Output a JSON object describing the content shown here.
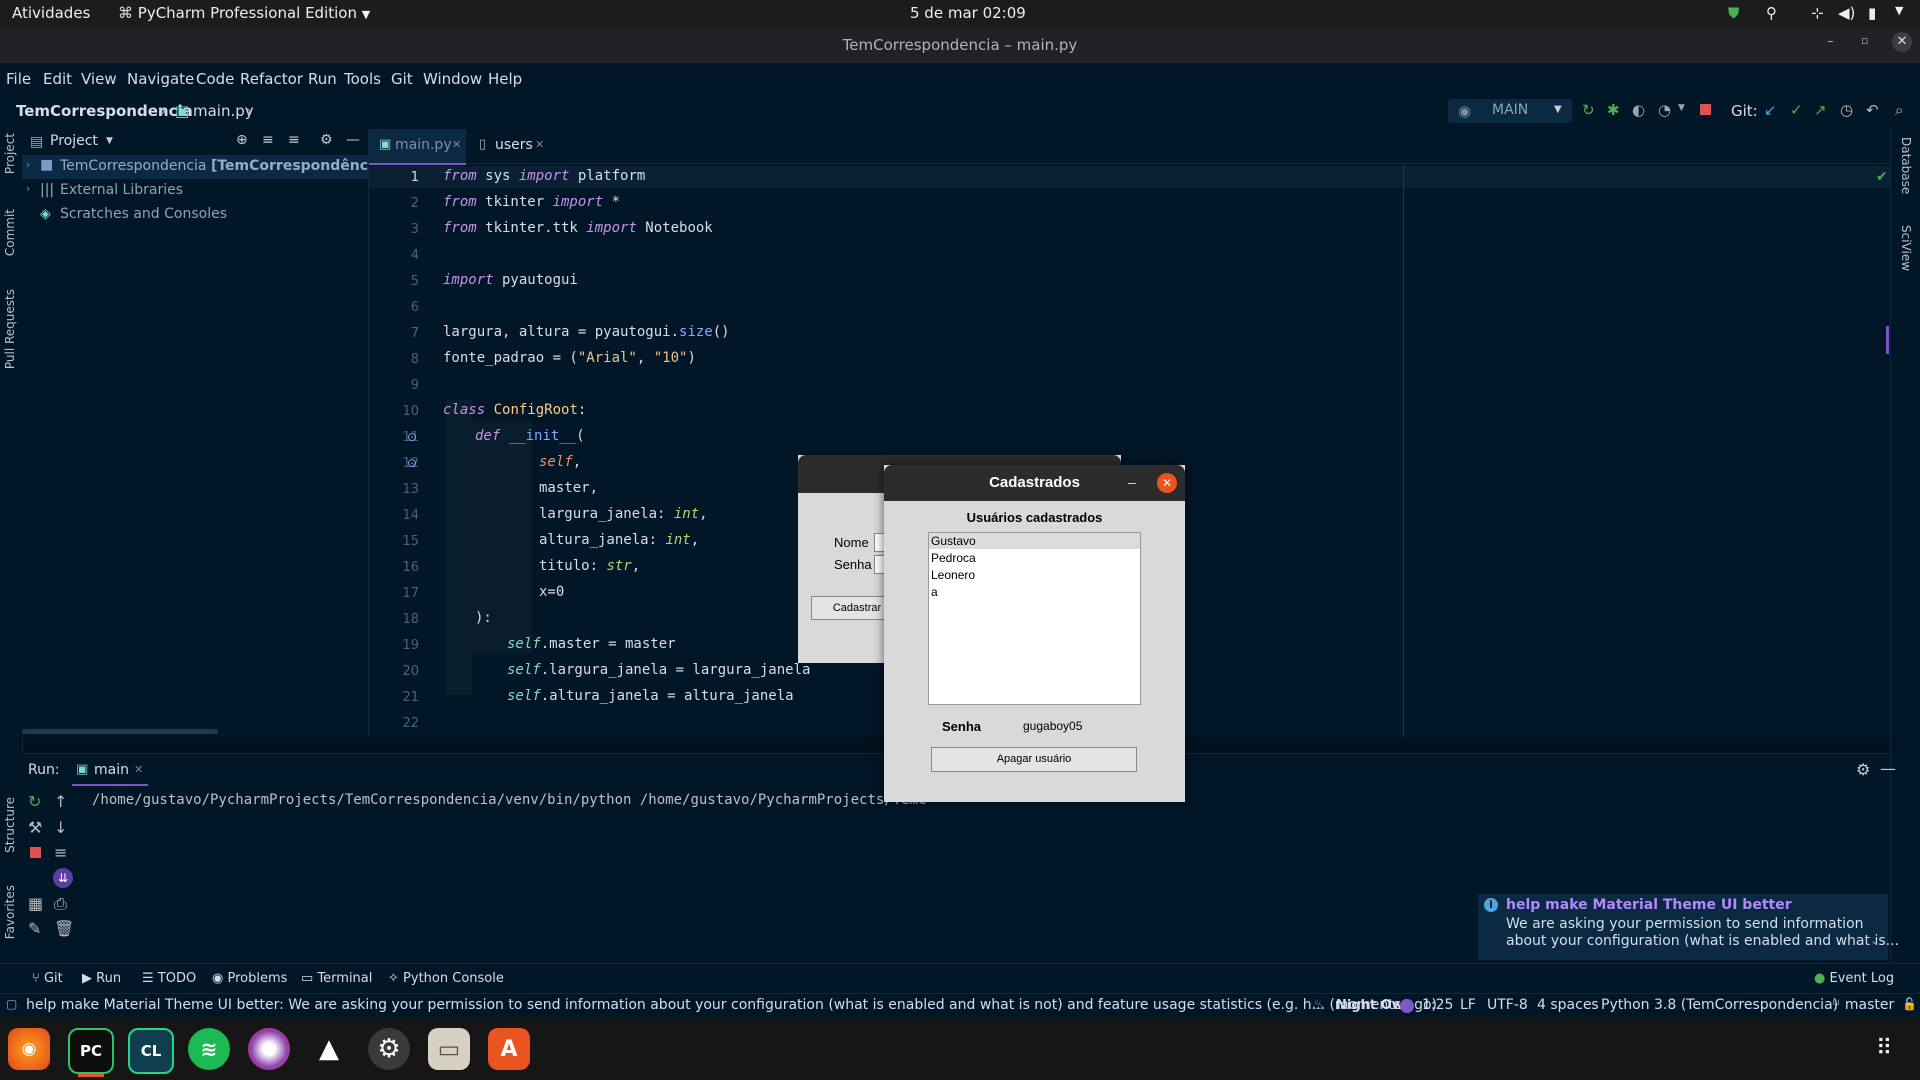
{
  "topbar": {
    "activities": "Atividades",
    "app_name": "PyCharm Professional Edition",
    "clock": "5 de mar  02:09"
  },
  "window": {
    "title": "TemCorrespondencia – main.py"
  },
  "menu": [
    "File",
    "Edit",
    "View",
    "Navigate",
    "Code",
    "Refactor",
    "Run",
    "Tools",
    "Git",
    "Window",
    "Help"
  ],
  "breadcrumb": {
    "project": "TemCorrespondencia",
    "file": "main.py"
  },
  "run_config": {
    "name": "MAIN",
    "git_label": "Git:"
  },
  "project_panel": {
    "title": "Project",
    "items": [
      {
        "label": "TemCorrespondencia",
        "suffix": "[TemCorrespondência]",
        "path": "~/"
      },
      {
        "label": "External Libraries"
      },
      {
        "label": "Scratches and Consoles"
      }
    ]
  },
  "left_strip": {
    "project": "Project",
    "commit": "Commit",
    "pull_requests": "Pull Requests",
    "structure": "Structure",
    "favorites": "Favorites"
  },
  "right_strip": {
    "database": "Database",
    "sciview": "SciView"
  },
  "editor": {
    "tabs": [
      {
        "label": "main.py",
        "active": true
      },
      {
        "label": "users",
        "active": false
      }
    ],
    "lines": [
      "1",
      "2",
      "3",
      "4",
      "5",
      "6",
      "7",
      "8",
      "9",
      "10",
      "11",
      "12",
      "13",
      "14",
      "15",
      "16",
      "17",
      "18",
      "19",
      "20",
      "21",
      "22"
    ],
    "code": {
      "l1": {
        "kw1": "from",
        "mod": " sys ",
        "kw2": "import",
        "name": " platform"
      },
      "l2": {
        "kw1": "from",
        "mod": " tkinter ",
        "kw2": "import",
        "name": " *"
      },
      "l3": {
        "kw1": "from",
        "mod": " tkinter.ttk ",
        "kw2": "import",
        "name": " Notebook"
      },
      "l5": {
        "kw1": "import",
        "name": " pyautogui"
      },
      "l7": {
        "a": "largura, altura = pyautogui.",
        "fn": "size",
        "b": "()"
      },
      "l8": {
        "a": "fonte_padrao = (",
        "s1": "\"Arial\"",
        "c": ", ",
        "s2": "\"10\"",
        "d": ")"
      },
      "l11": {
        "kw": "class",
        "name": " ConfigRoot",
        "end": ":"
      },
      "l12": {
        "kw": "def",
        "name": " __init__",
        "end": "("
      },
      "l13": {
        "self": "self",
        "end": ","
      },
      "l14": {
        "text": "master,"
      },
      "l15": {
        "name": "largura_janela: ",
        "typ": "int",
        "end": ","
      },
      "l16": {
        "name": "altura_janela: ",
        "typ": "int",
        "end": ","
      },
      "l17": {
        "name": "titulo: ",
        "typ": "str",
        "end": ","
      },
      "l18": {
        "text": "x=0"
      },
      "l19": {
        "text": "):"
      },
      "l20": {
        "self": "self",
        "rest": ".master = master"
      },
      "l21": {
        "self": "self",
        "rest": ".largura_janela = largura_janela"
      },
      "l22": {
        "self": "self",
        "rest": ".altura_janela = altura_janela"
      }
    }
  },
  "run_panel": {
    "label": "Run:",
    "tab": "main",
    "command": "/home/gustavo/PycharmProjects/TemCorrespondencia/venv/bin/python /home/gustavo/PycharmProjects/TemC"
  },
  "notification": {
    "title": "help make Material Theme UI better",
    "body1": "We are asking your permission to send information",
    "body2": "about your configuration (what is enabled and what is..."
  },
  "tool_tabs": [
    "Git",
    "Run",
    "TODO",
    "Problems",
    "Terminal",
    "Python Console"
  ],
  "event_log": "Event Log",
  "status": {
    "message": "help make Material Theme UI better: We are asking your permission to send information about your configuration (what is enabled and what is not) and feature usage statistics (e.g. h... (moments ago)",
    "theme": "Night Owl",
    "position": "1:25",
    "line_sep": "LF",
    "encoding": "UTF-8",
    "indent": "4 spaces",
    "interpreter": "Python 3.8 (TemCorrespondencia)",
    "branch": "master"
  },
  "tk_back": {
    "nome_label": "Nome",
    "senha_label": "Senha",
    "cadastrar": "Cadastrar"
  },
  "tk_cadastrados": {
    "title": "Cadastrados",
    "heading": "Usuários cadastrados",
    "users": [
      "Gustavo",
      "Pedroca",
      "Leonero",
      "a"
    ],
    "selected_index": 0,
    "senha_label": "Senha",
    "senha_value": "gugaboy05",
    "delete_button": "Apagar usuário"
  },
  "dock": [
    "firefox",
    "pycharm",
    "clion",
    "spotify",
    "app",
    "inkscape",
    "settings",
    "files",
    "software"
  ]
}
